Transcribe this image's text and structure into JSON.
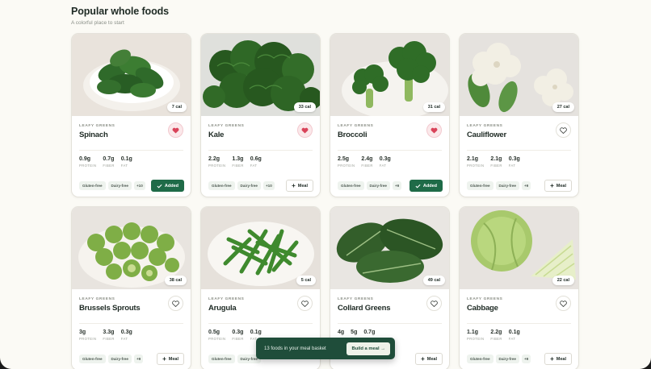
{
  "header": {
    "title": "Popular whole foods",
    "subtitle": "A colorful place to start"
  },
  "colors": {
    "accent": "#1f6b48",
    "favorite": "#d9435a",
    "basket_bar": "#1f4d3a"
  },
  "cards": [
    {
      "name": "Spinach",
      "category": "LEAFY GREENS",
      "calories": "7 cal",
      "favorited": true,
      "macros": [
        {
          "value": "0.9g",
          "label": "PROTEIN"
        },
        {
          "value": "0.7g",
          "label": "FIBER"
        },
        {
          "value": "0.1g",
          "label": "FAT"
        }
      ],
      "tags": [
        "Gluten-free",
        "Dairy-free"
      ],
      "more": "+10",
      "action": "Added",
      "added": true
    },
    {
      "name": "Kale",
      "category": "LEAFY GREENS",
      "calories": "33 cal",
      "favorited": true,
      "macros": [
        {
          "value": "2.2g",
          "label": "PROTEIN"
        },
        {
          "value": "1.3g",
          "label": "FIBER"
        },
        {
          "value": "0.6g",
          "label": "FAT"
        }
      ],
      "tags": [
        "Gluten-free",
        "Dairy-free"
      ],
      "more": "+10",
      "action": "Meal",
      "added": false
    },
    {
      "name": "Broccoli",
      "category": "LEAFY GREENS",
      "calories": "31 cal",
      "favorited": true,
      "macros": [
        {
          "value": "2.5g",
          "label": "PROTEIN"
        },
        {
          "value": "2.4g",
          "label": "FIBER"
        },
        {
          "value": "0.3g",
          "label": "FAT"
        }
      ],
      "tags": [
        "Gluten-free",
        "Dairy-free"
      ],
      "more": "+9",
      "action": "Added",
      "added": true
    },
    {
      "name": "Cauliflower",
      "category": "LEAFY GREENS",
      "calories": "27 cal",
      "favorited": false,
      "macros": [
        {
          "value": "2.1g",
          "label": "PROTEIN"
        },
        {
          "value": "2.1g",
          "label": "FIBER"
        },
        {
          "value": "0.3g",
          "label": "FAT"
        }
      ],
      "tags": [
        "Gluten-free",
        "Dairy-free"
      ],
      "more": "+9",
      "action": "Meal",
      "added": false
    },
    {
      "name": "Brussels Sprouts",
      "category": "LEAFY GREENS",
      "calories": "38 cal",
      "favorited": false,
      "macros": [
        {
          "value": "3g",
          "label": "PROTEIN"
        },
        {
          "value": "3.3g",
          "label": "FIBER"
        },
        {
          "value": "0.3g",
          "label": "FAT"
        }
      ],
      "tags": [
        "Gluten-free",
        "Dairy-free"
      ],
      "more": "+9",
      "action": "Meal",
      "added": false
    },
    {
      "name": "Arugula",
      "category": "LEAFY GREENS",
      "calories": "5 cal",
      "favorited": false,
      "macros": [
        {
          "value": "0.5g",
          "label": "PROTEIN"
        },
        {
          "value": "0.3g",
          "label": "FIBER"
        },
        {
          "value": "0.1g",
          "label": "FAT"
        }
      ],
      "tags": [
        "Gluten-free",
        "Dairy-free"
      ],
      "more": "",
      "action": "",
      "added": false
    },
    {
      "name": "Collard Greens",
      "category": "LEAFY GREENS",
      "calories": "49 cal",
      "favorited": false,
      "macros": [
        {
          "value": "4g",
          "label": ""
        },
        {
          "value": "5g",
          "label": ""
        },
        {
          "value": "0.7g",
          "label": ""
        }
      ],
      "tags": [],
      "more": "",
      "action": "Meal",
      "added": false
    },
    {
      "name": "Cabbage",
      "category": "LEAFY GREENS",
      "calories": "22 cal",
      "favorited": false,
      "macros": [
        {
          "value": "1.1g",
          "label": "PROTEIN"
        },
        {
          "value": "2.2g",
          "label": "FIBER"
        },
        {
          "value": "0.1g",
          "label": "FAT"
        }
      ],
      "tags": [
        "Gluten-free",
        "Dairy-free"
      ],
      "more": "+9",
      "action": "Meal",
      "added": false
    }
  ],
  "basket": {
    "text": "13 foods in your meal basket",
    "button": "Build a meal →"
  }
}
